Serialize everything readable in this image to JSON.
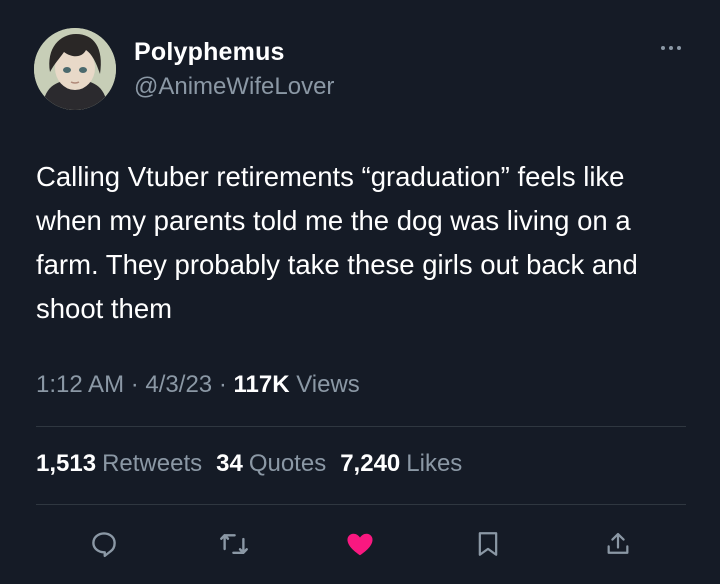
{
  "author": {
    "display_name": "Polyphemus",
    "handle": "@AnimeWifeLover"
  },
  "tweet": {
    "text": "Calling Vtuber retirements “graduation” feels like when my parents told me the dog was living on a farm. They probably take these girls out back and shoot them"
  },
  "meta": {
    "time": "1:12 AM",
    "separator": "·",
    "date": "4/3/23",
    "views_count": "117K",
    "views_label": "Views"
  },
  "stats": {
    "retweets_count": "1,513",
    "retweets_label": "Retweets",
    "quotes_count": "34",
    "quotes_label": "Quotes",
    "likes_count": "7,240",
    "likes_label": "Likes"
  },
  "actions": [
    "reply-icon",
    "retweet-icon",
    "like-icon",
    "bookmark-icon",
    "share-icon"
  ],
  "colors": {
    "background": "#151b26",
    "primary_text": "#ffffff",
    "secondary_text": "#8b98a5",
    "like": "#f91880",
    "divider": "#2f3740"
  }
}
